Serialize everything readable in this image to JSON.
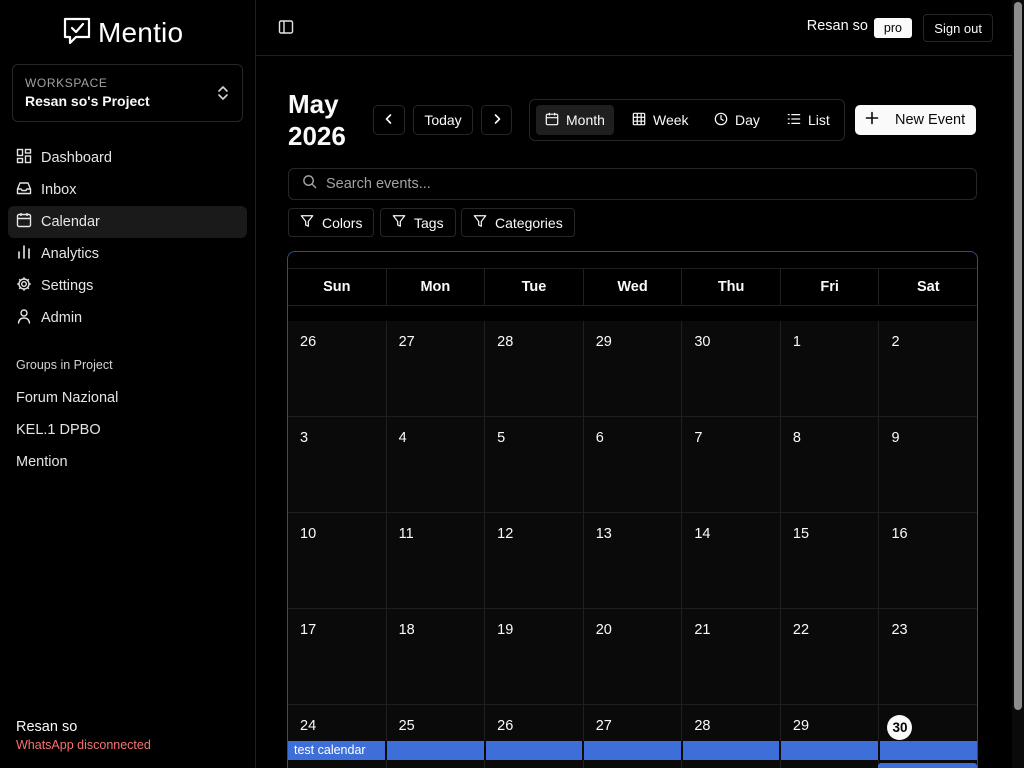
{
  "sidebar": {
    "logo": "Mentio",
    "workspace_label": "WORKSPACE",
    "workspace_name": "Resan so's Project",
    "nav": [
      {
        "label": "Dashboard",
        "icon": "dashboard-icon"
      },
      {
        "label": "Inbox",
        "icon": "inbox-icon"
      },
      {
        "label": "Calendar",
        "icon": "calendar-icon",
        "active": true
      },
      {
        "label": "Analytics",
        "icon": "analytics-icon"
      },
      {
        "label": "Settings",
        "icon": "gear-icon"
      },
      {
        "label": "Admin",
        "icon": "user-icon"
      }
    ],
    "groups_heading": "Groups in Project",
    "groups": [
      "Forum Nazional",
      "KEL.1 DPBO",
      "Mention"
    ],
    "user_name": "Resan so",
    "user_status": "WhatsApp disconnected"
  },
  "topbar": {
    "user_name": "Resan so",
    "plan_badge": "pro",
    "signout_label": "Sign out"
  },
  "calendar": {
    "title_month": "May",
    "title_year": "2026",
    "today_label": "Today",
    "views": [
      "Month",
      "Week",
      "Day",
      "List"
    ],
    "active_view": "Month",
    "new_event_label": "New Event",
    "search_placeholder": "Search events...",
    "filters": [
      "Colors",
      "Tags",
      "Categories"
    ],
    "weekdays": [
      "Sun",
      "Mon",
      "Tue",
      "Wed",
      "Thu",
      "Fri",
      "Sat"
    ],
    "weeks": [
      [
        "26",
        "27",
        "28",
        "29",
        "30",
        "1",
        "2"
      ],
      [
        "3",
        "4",
        "5",
        "6",
        "7",
        "8",
        "9"
      ],
      [
        "10",
        "11",
        "12",
        "13",
        "14",
        "15",
        "16"
      ],
      [
        "17",
        "18",
        "19",
        "20",
        "21",
        "22",
        "23"
      ],
      [
        "24",
        "25",
        "26",
        "27",
        "28",
        "29",
        "30"
      ]
    ],
    "today_day": "30",
    "events": [
      {
        "title": "test calendar",
        "color": "#3e6fd8"
      }
    ]
  },
  "colors": {
    "accent": "#3e6fd8",
    "status_error": "#f87171",
    "background": "#000000"
  }
}
